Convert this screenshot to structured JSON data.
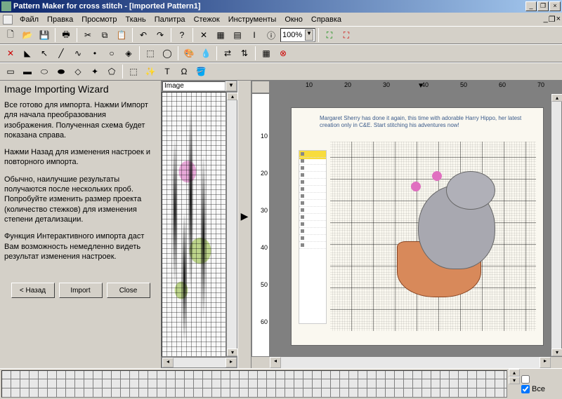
{
  "title": "Pattern Maker for cross stitch - [Imported Pattern1]",
  "menu": [
    "Файл",
    "Правка",
    "Просмотр",
    "Ткань",
    "Палитра",
    "Стежок",
    "Инструменты",
    "Окно",
    "Справка"
  ],
  "zoom": "100%",
  "wizard": {
    "title": "Image Importing Wizard",
    "p1": "Все готово для импорта.  Нажми Импорт для начала преобразования изображения.  Полученная схема будет показана справа.",
    "p2": "Нажми Назад для изменения настроек и повторного импорта.",
    "p3": "Обычно, наилучшие результаты получаются после нескольких проб.  Попробуйте изменить размер проекта (количество стежков) для изменения степени детализации.",
    "p4": "Функция Интерактивного импорта даст Вам возможность немедленно видеть результат изменения настроек.",
    "back": "< Назад",
    "import": "Import",
    "close": "Close"
  },
  "image_label": "Image",
  "ruler_h": [
    "10",
    "20",
    "30",
    "40",
    "50",
    "60",
    "70"
  ],
  "ruler_v": [
    "10",
    "20",
    "30",
    "40",
    "50",
    "60"
  ],
  "pattern_text": "Margaret Sherry has done it again, this time with adorable Harry Hippo, her latest creation only in C&E. Start stitching his adventures now!",
  "bottom": {
    "all": "Все"
  },
  "chart_data": null
}
